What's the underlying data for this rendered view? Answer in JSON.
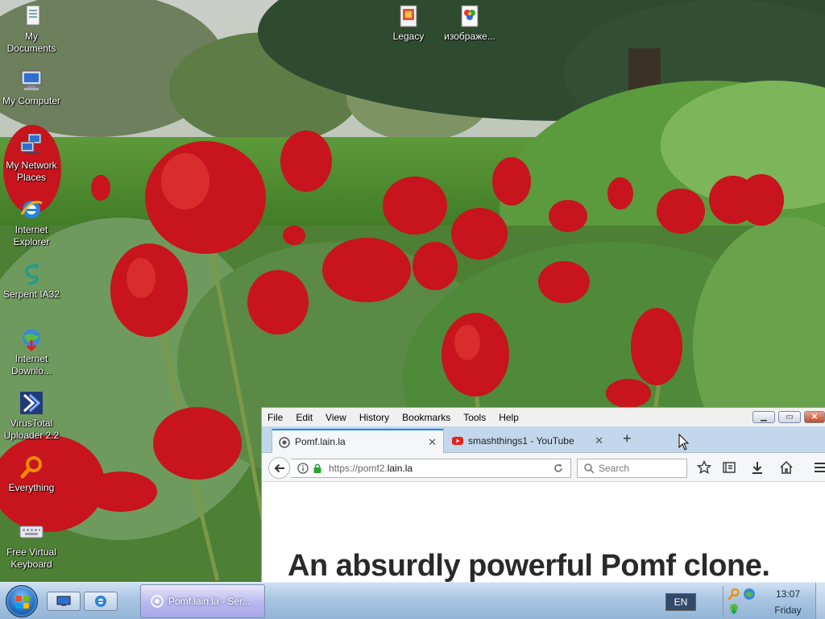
{
  "desktop": {
    "icons": [
      {
        "label": "My\nDocuments",
        "icon": "my-documents-icon"
      },
      {
        "label": "My Computer",
        "icon": "my-computer-icon"
      },
      {
        "label": "My Network\nPlaces",
        "icon": "network-places-icon"
      },
      {
        "label": "Internet\nExplorer",
        "icon": "internet-explorer-icon"
      },
      {
        "label": "Serpent IA32",
        "icon": "serpent-icon"
      },
      {
        "label": "Internet\nDownlo...",
        "icon": "internet-download-icon"
      },
      {
        "label": "VirusTotal\nUploader 2.2",
        "icon": "virustotal-icon"
      },
      {
        "label": "Everything",
        "icon": "everything-search-icon"
      },
      {
        "label": "Free Virtual\nKeyboard",
        "icon": "virtual-keyboard-icon"
      },
      {
        "label": "Legacy",
        "icon": "legacy-icon"
      },
      {
        "label": "изображе...",
        "icon": "image-file-icon"
      }
    ]
  },
  "browser": {
    "menu": [
      "File",
      "Edit",
      "View",
      "History",
      "Bookmarks",
      "Tools",
      "Help"
    ],
    "tabs": [
      {
        "title": "Pomf.lain.la",
        "active": true,
        "icon": "pomf-favicon"
      },
      {
        "title": "smashthings1 - YouTube",
        "active": false,
        "icon": "youtube-icon"
      }
    ],
    "url_prefix": "https://pomf2.",
    "url_host": "lain.la",
    "search_placeholder": "Search",
    "page": {
      "headline": "An absurdly powerful Pomf clone."
    }
  },
  "taskbar": {
    "task_button_label": "Pomf.lain.la - Ser...",
    "language": "EN",
    "clock_time": "13:07",
    "clock_day": "Friday"
  },
  "colors": {
    "accent": "#0a84ff",
    "taskbar": "#a9c5e2",
    "youtube_red": "#e62117"
  }
}
